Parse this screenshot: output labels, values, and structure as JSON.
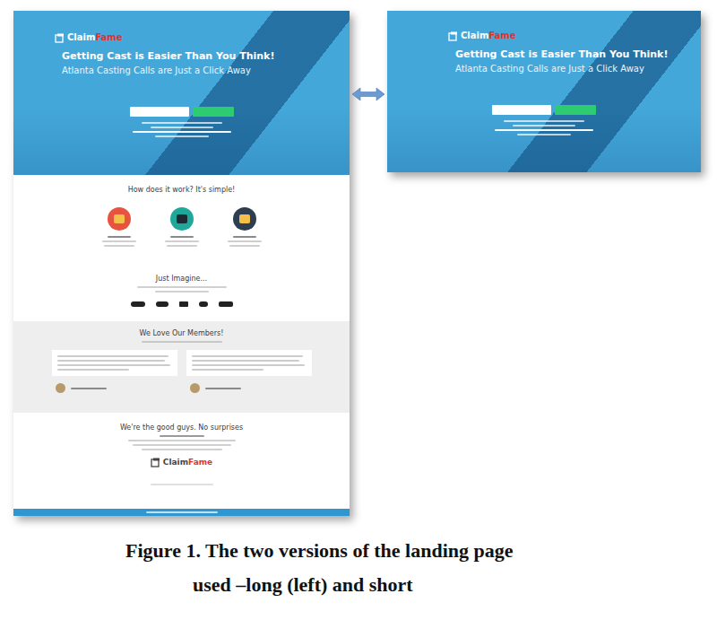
{
  "long_page": {
    "variant": "long",
    "logo": {
      "first": "Claim",
      "second": "Fame"
    },
    "hero": {
      "headline": "Getting Cast is Easier Than You Think!",
      "subline": "Atlanta Casting Calls are Just a Click Away"
    },
    "how_title": "How does it work? It's simple!",
    "steps": [
      {
        "color": "#e8533f"
      },
      {
        "color": "#1fa89a"
      },
      {
        "color": "#2c3e50"
      }
    ],
    "imagine_title": "Just Imagine...",
    "members_title": "We Love Our Members!",
    "good_title": "We're the good guys. No surprises"
  },
  "short_page": {
    "variant": "short",
    "logo": {
      "first": "Claim",
      "second": "Fame"
    },
    "hero": {
      "headline": "Getting Cast is Easier Than You Think!",
      "subline": "Atlanta Casting Calls are Just a Click Away"
    }
  },
  "caption": {
    "lines": [
      "Figure 1. The two versions of the landing page",
      "used –long (left) and short"
    ]
  }
}
